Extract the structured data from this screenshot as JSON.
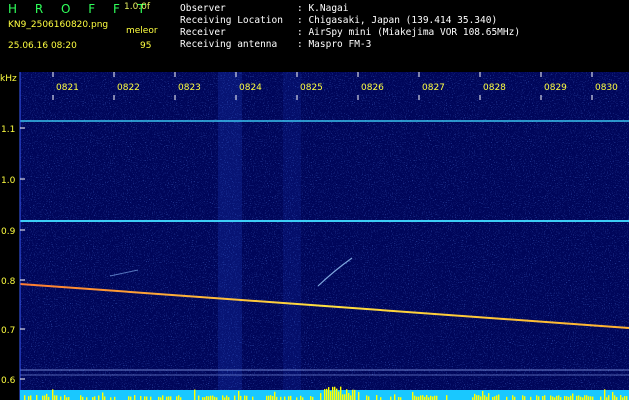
{
  "header": {
    "app_title": "H R O F F T",
    "version": "1.0.0f",
    "filename": "KN9_2506160820.png",
    "mode": "meleor",
    "datetime": "25.06.16 08:20",
    "count": "95"
  },
  "meta": [
    {
      "label": "Observer",
      "value": ": K.Nagai"
    },
    {
      "label": "Receiving Location",
      "value": ": Chigasaki, Japan (139.414 35.340)"
    },
    {
      "label": "Receiver",
      "value": ": AirSpy mini (Miakejima VOR 108.65MHz)"
    },
    {
      "label": "Receiving antenna",
      "value": ": Maspro FM-3"
    }
  ],
  "axis": {
    "y_unit": "kHz",
    "y_ticks": [
      "1.1",
      "1.0",
      "0.9",
      "0.8",
      "0.7",
      "0.6"
    ],
    "time_labels": [
      "0821",
      "0822",
      "0823",
      "0824",
      "0825",
      "0826",
      "0827",
      "0828",
      "0829",
      "0830"
    ]
  },
  "colors": {
    "background": "#000000",
    "spectrogram_base": "#00065a",
    "carrier_line": "#40d8ff",
    "meteor_trace": "#ffd040",
    "label_yellow": "#ffff40",
    "title_green": "#2fff5a",
    "level_cyan": "#19c8ff",
    "level_yellow": "#ffff00"
  }
}
